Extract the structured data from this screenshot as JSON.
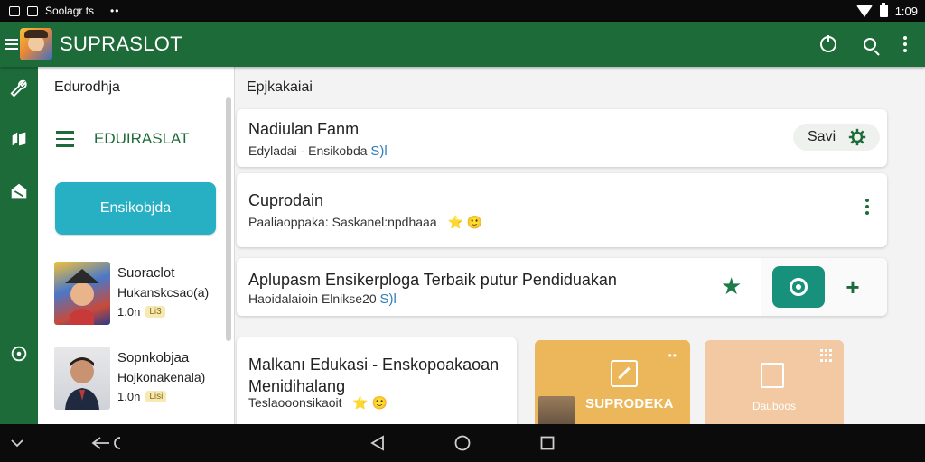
{
  "status_bar": {
    "notification_text": "Soolagr ts",
    "dots": "••",
    "time": "1:09"
  },
  "app_bar": {
    "title": "SUPRASLOT"
  },
  "drawer": {
    "header": "Edurodhja",
    "nav_label": "EDUIRASLAT",
    "cta_label": "Ensikobjda",
    "items": [
      {
        "title": "Suoraclot",
        "subtitle": "Hukanskcsao(a)",
        "meta": "1.0n",
        "badge": "Li3"
      },
      {
        "title": "Sopnkobjaa",
        "subtitle": "Hojkonakenala)",
        "meta": "1.0n",
        "badge": "Lisi"
      }
    ]
  },
  "main": {
    "header": "Epjkakaiai",
    "cards": [
      {
        "title": "Nadiulan Fanm",
        "subtitle": "Edyladai - Ensikobda",
        "tag": "S)l",
        "save_label": "Savi"
      },
      {
        "title": "Cuprodain",
        "subtitle": "Paaliaoppaka: Saskanel:npdhaaa",
        "emoji": "⭐ 🙂"
      },
      {
        "title": "Aplupasm Ensikerploga Terbaik putur Pendiduakan",
        "subtitle": "Haoidalaioin Elnikse20",
        "tag": "S)l"
      },
      {
        "title": "Malkanı Edukasi - Enskopoakaoan Menidihalang",
        "subtitle": "Teslaooonsikaoit",
        "emoji": "⭐ 🙂"
      }
    ],
    "tiles": [
      {
        "label": "SUPRODEKA"
      },
      {
        "label": "Dauboos"
      }
    ]
  },
  "colors": {
    "primary": "#1e6b3a",
    "accent_teal": "#27b0c3",
    "action_teal": "#17917b",
    "tile_gold": "#ecb75a",
    "tile_peach": "#f2c9a2"
  },
  "icons": {
    "app_bar": [
      "menu-icon",
      "power-icon",
      "search-icon",
      "more-vert-icon"
    ],
    "rail": [
      "wrench-icon",
      "book-icon",
      "tag-icon",
      "circle-icon"
    ],
    "navbar": [
      "chevron-down-icon",
      "back-icon",
      "home-icon",
      "recents-icon"
    ]
  }
}
